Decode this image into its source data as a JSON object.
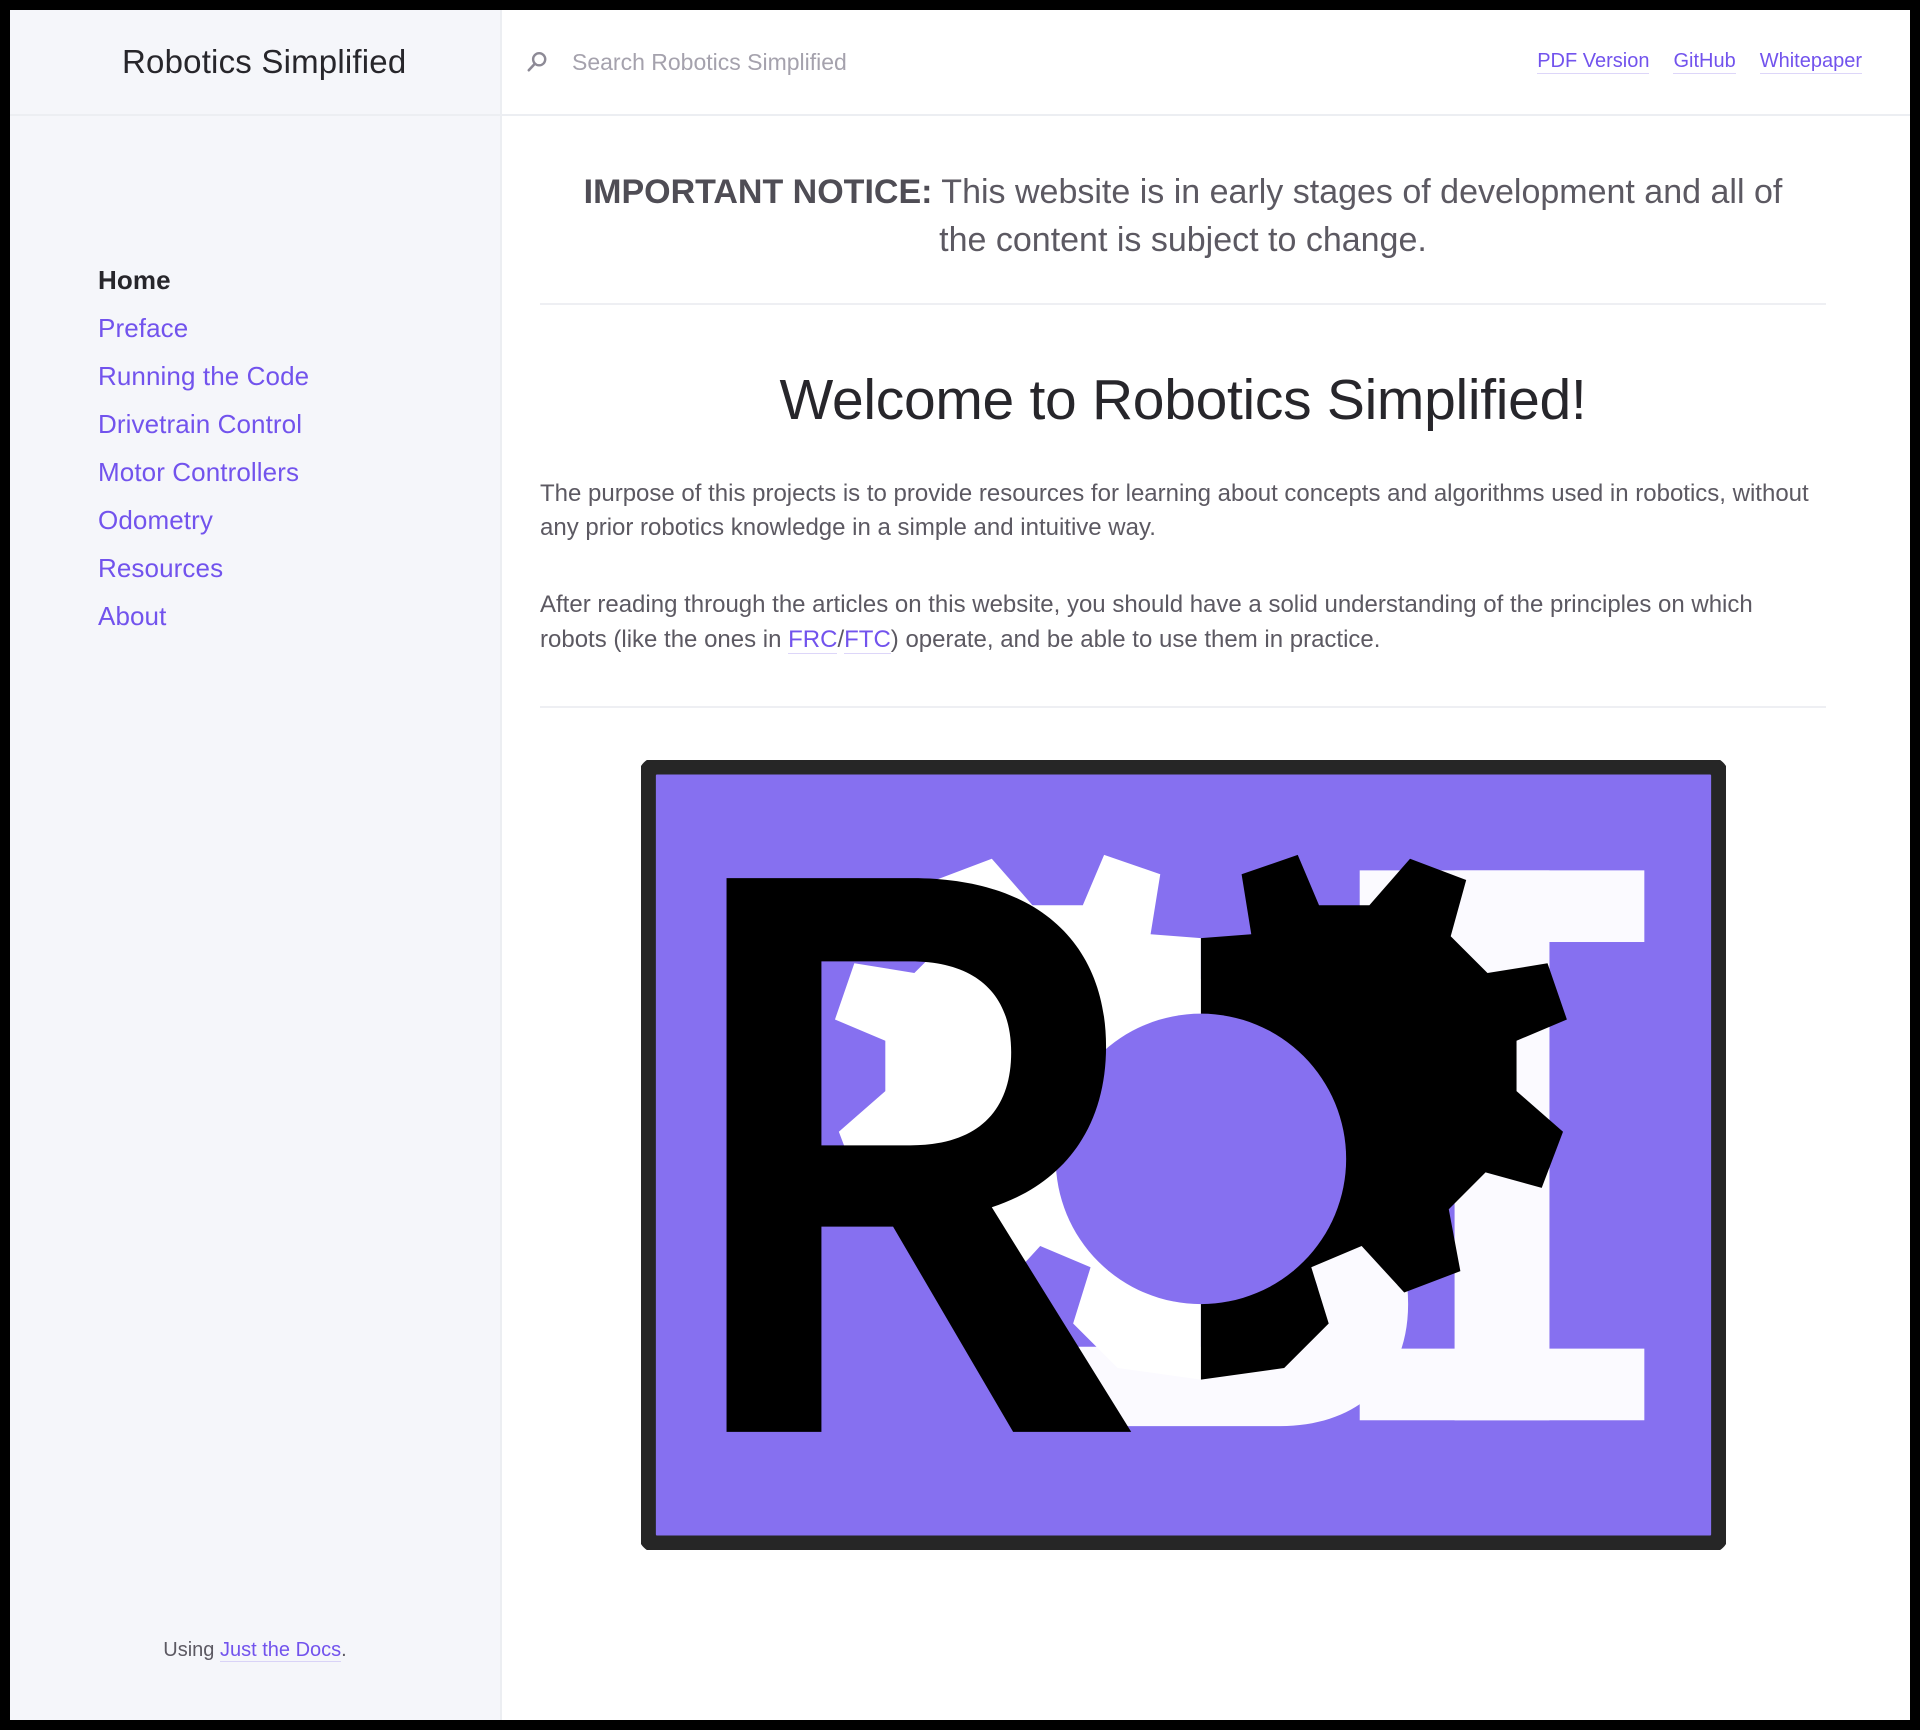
{
  "sidebar": {
    "site_title": "Robotics Simplified",
    "nav_items": [
      {
        "label": "Home",
        "active": true
      },
      {
        "label": "Preface",
        "active": false
      },
      {
        "label": "Running the Code",
        "active": false
      },
      {
        "label": "Drivetrain Control",
        "active": false
      },
      {
        "label": "Motor Controllers",
        "active": false
      },
      {
        "label": "Odometry",
        "active": false
      },
      {
        "label": "Resources",
        "active": false
      },
      {
        "label": "About",
        "active": false
      }
    ],
    "footer": {
      "prefix": "Using ",
      "link_label": "Just the Docs",
      "suffix": "."
    }
  },
  "header": {
    "search": {
      "icon": "search-icon",
      "placeholder": "Search Robotics Simplified",
      "value": ""
    },
    "aux_links": [
      {
        "label": "PDF Version"
      },
      {
        "label": "GitHub"
      },
      {
        "label": "Whitepaper"
      }
    ]
  },
  "main": {
    "notice": {
      "strong": "IMPORTANT NOTICE:",
      "text": " This website is in early stages of development and all of the content is subject to change."
    },
    "page_title": "Welcome to Robotics Simplified!",
    "paragraph_1": "The purpose of this projects is to provide resources for learning about concepts and algorithms used in robotics, without any prior robotics knowledge in a simple and intuitive way.",
    "paragraph_2": {
      "part_1": "After reading through the articles on this website, you should have a solid understanding of the principles on which robots (like the ones in ",
      "link_1": "FRC",
      "separator": "/",
      "link_2": "FTC",
      "part_2": ") operate, and be able to use them in practice."
    },
    "logo": {
      "name": "robotics-simplified-logo",
      "alt": "RSI logo: black letter R, split white and black gear, white letter S, white letter I on purple background"
    }
  },
  "colors": {
    "accent_purple": "#7253ed",
    "logo_purple": "#8670f0",
    "logo_border": "#262626",
    "sidebar_bg": "#f5f6fa",
    "border": "#eceef2",
    "text_body": "#5c5962",
    "text_heading": "#27262b",
    "page_bg": "#ffffff",
    "frame_bg": "#000000"
  }
}
